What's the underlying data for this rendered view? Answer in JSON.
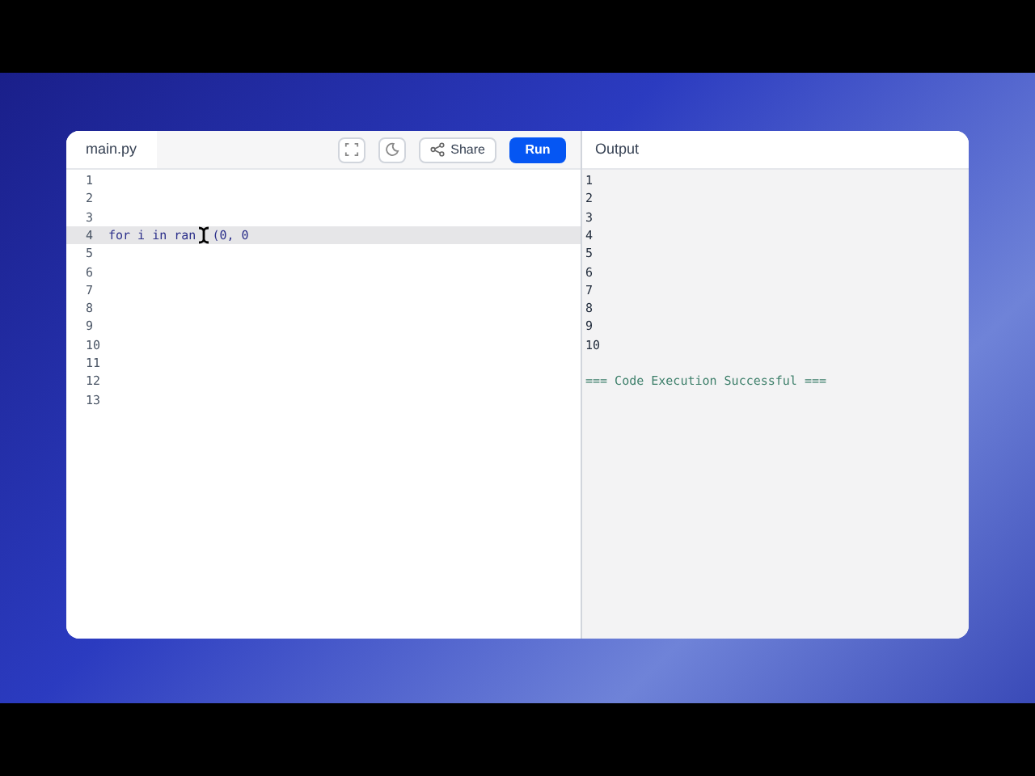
{
  "editor": {
    "tab": {
      "label": "main.py",
      "selected": true
    },
    "toolbar": {
      "share": "Share",
      "run": "Run"
    },
    "lines": [
      {
        "number": "1",
        "current": false
      },
      {
        "number": "2",
        "current": false
      },
      {
        "number": "3",
        "current": false
      },
      {
        "number": "4",
        "segments": [
          "for i in ran",
          "(0, 0"
        ],
        "current": true
      },
      {
        "number": "5",
        "current": false
      },
      {
        "number": "6",
        "current": false
      },
      {
        "number": "7",
        "current": false
      },
      {
        "number": "8",
        "current": false
      },
      {
        "number": "9",
        "current": false
      },
      {
        "number": "10",
        "current": false
      },
      {
        "number": "11",
        "current": false
      },
      {
        "number": "12",
        "current": false
      },
      {
        "number": "13",
        "current": false
      }
    ]
  },
  "output": {
    "title": "Output",
    "lines": [
      {
        "kind": "text",
        "text": "1"
      },
      {
        "kind": "text",
        "text": "2"
      },
      {
        "kind": "text",
        "text": "3"
      },
      {
        "kind": "text",
        "text": "4"
      },
      {
        "kind": "text",
        "text": "5"
      },
      {
        "kind": "text",
        "text": "6"
      },
      {
        "kind": "text",
        "text": "7"
      },
      {
        "kind": "text",
        "text": "8"
      },
      {
        "kind": "text",
        "text": "9"
      },
      {
        "kind": "text",
        "text": "10"
      },
      {
        "kind": "blank"
      },
      {
        "kind": "success",
        "text": "=== Code Execution Successful ==="
      }
    ]
  }
}
